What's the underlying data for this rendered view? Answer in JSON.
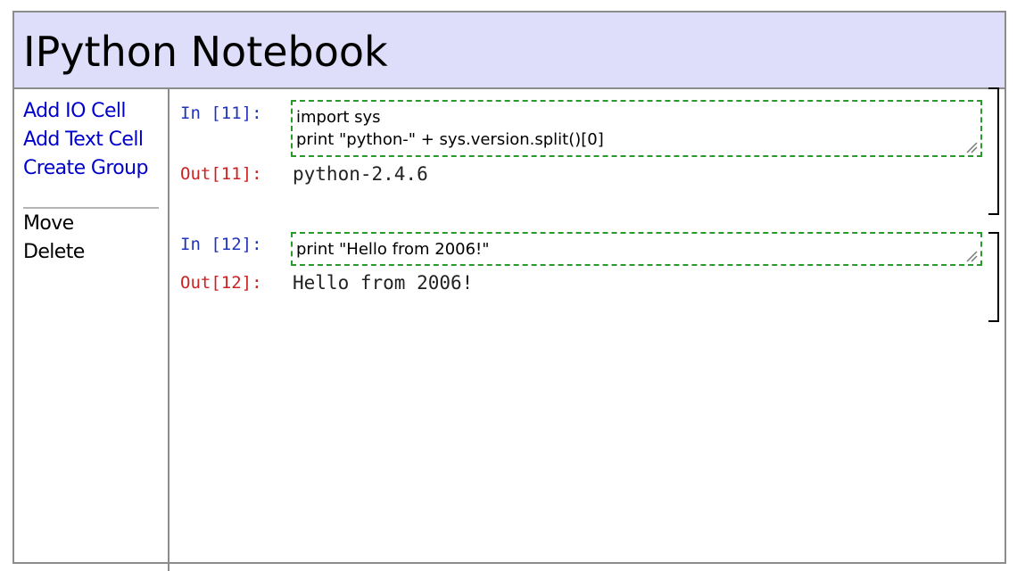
{
  "header": {
    "title": "IPython Notebook"
  },
  "sidebar": {
    "links": [
      {
        "label": "Add IO Cell"
      },
      {
        "label": "Add Text Cell"
      },
      {
        "label": "Create Group"
      }
    ],
    "actions": [
      {
        "label": "Move"
      },
      {
        "label": "Delete"
      }
    ]
  },
  "cells": [
    {
      "in_prompt": "In [11]:",
      "input_lines": [
        "import sys",
        "print \"python-\" + sys.version.split()[0]"
      ],
      "out_prompt": "Out[11]:",
      "output": "python-2.4.6"
    },
    {
      "in_prompt": "In [12]:",
      "input_lines": [
        "print \"Hello from 2006!\""
      ],
      "out_prompt": "Out[12]:",
      "output": "Hello from 2006!"
    }
  ],
  "colors": {
    "header_bg": "#dedefa",
    "link": "#0000cc",
    "in_prompt": "#2233bb",
    "out_prompt": "#cc2222",
    "input_border": "#2a9a2a"
  }
}
